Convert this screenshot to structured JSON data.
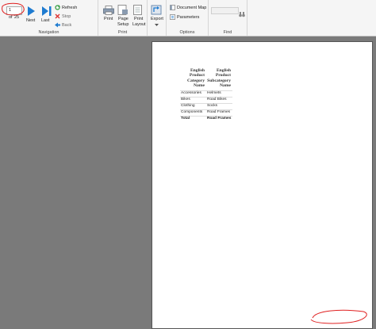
{
  "navigation": {
    "page_current": "1",
    "page_of": "of",
    "page_total": "25",
    "next_label": "Next",
    "last_label": "Last",
    "refresh_label": "Refresh",
    "stop_label": "Stop",
    "back_label": "Back",
    "group_label": "Navigation"
  },
  "print": {
    "print_label": "Print",
    "page_setup_label": [
      "Page",
      "Setup"
    ],
    "print_layout_label": [
      "Print",
      "Layout"
    ],
    "group_label": "Print"
  },
  "export": {
    "export_label": "Export",
    "group_label": ""
  },
  "options": {
    "document_map_label": "Document Map",
    "parameters_label": "Parameters",
    "group_label": "Options"
  },
  "find": {
    "search_value": "",
    "group_label": "Find"
  },
  "report": {
    "headers": [
      [
        "English",
        "Product",
        "Category",
        "Name"
      ],
      [
        "English",
        "Product",
        "Subcategory",
        "Name"
      ]
    ],
    "rows": [
      [
        "Accessories",
        "Helmets"
      ],
      [
        "Bikes",
        "Road Bikes"
      ],
      [
        "Clothing",
        "Socks"
      ],
      [
        "Components",
        "Road Frames"
      ]
    ],
    "total": [
      "Total",
      "Road Frames"
    ]
  },
  "colors": {
    "accent": "#1e7bd0",
    "annotation": "#e02020",
    "ribbon_bg": "#f5f5f5",
    "canvas_bg": "#7a7a7a"
  }
}
